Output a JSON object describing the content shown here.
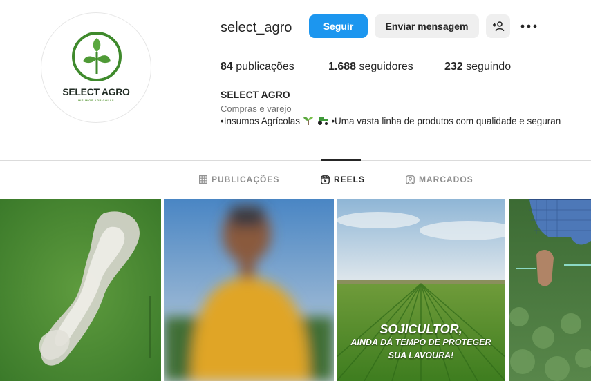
{
  "profile": {
    "username": "select_agro",
    "logo_text": "SELECT AGRO",
    "logo_subtext": "INSUMOS AGRÍCOLAS",
    "follow_label": "Seguir",
    "message_label": "Enviar mensagem",
    "adduser_icon": "person-plus-icon",
    "more_icon": "more-horizontal-icon"
  },
  "stats": {
    "posts_count": "84",
    "posts_label": "publicações",
    "followers_count": "1.688",
    "followers_label": "seguidores",
    "following_count": "232",
    "following_label": "seguindo"
  },
  "bio": {
    "name": "SELECT AGRO",
    "category": "Compras e varejo",
    "text_prefix": "•Insumos Agrícolas",
    "text_suffix": " •Uma vasta linha de produtos com qualidade e seguran"
  },
  "tabs": [
    {
      "label": "PUBLICAÇÕES",
      "icon": "grid-icon",
      "active": false
    },
    {
      "label": "REELS",
      "icon": "reels-icon",
      "active": true
    },
    {
      "label": "MARCADOS",
      "icon": "tagged-icon",
      "active": false
    }
  ],
  "reels": [
    {
      "kind": "aerial-field-photo"
    },
    {
      "kind": "blurred-person-yellow-shirt"
    },
    {
      "kind": "soybean-field",
      "caption_line1": "SOJICULTOR,",
      "caption_line2": "AINDA DÁ TEMPO DE PROTEGER",
      "caption_line3": "SUA LAVOURA!"
    },
    {
      "kind": "person-in-crop-field"
    }
  ],
  "colors": {
    "follow_button": "#1c96ef",
    "secondary_button": "#efefef",
    "text_primary": "#262626",
    "text_muted": "#737373",
    "brand_green": "#3f8a2c"
  }
}
